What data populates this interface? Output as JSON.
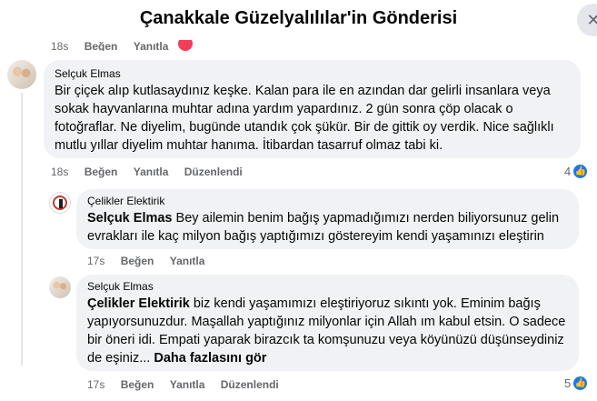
{
  "header": {
    "title": "Çanakkale Güzelyalılılar'in Gönderisi",
    "close_icon": "✕"
  },
  "previous_actions": {
    "time": "18s",
    "like": "Beğen",
    "reply": "Yanıtla"
  },
  "comments": [
    {
      "author": "Selçuk Elmas",
      "text": "Bir çiçek alıp kutlasaydınız keşke. Kalan para ile en azından dar gelirli insanlara veya sokak hayvanlarına muhtar adına yardım yapardınız. 2 gün sonra çöp olacak o fotoğraflar. Ne diyelim, bugünde utandık çok şükür. Bir de gittik oy verdik. Nice sağlıklı mutlu yıllar diyelim muhtar hanıma. İtibardan tasarruf olmaz tabi ki.",
      "time": "18s",
      "like": "Beğen",
      "reply": "Yanıtla",
      "edited": "Düzenlendi",
      "reaction_count": "4"
    },
    {
      "author": "Çelikler Elektirik",
      "mention": "Selçuk Elmas",
      "text": " Bey ailemin benim bağış yapmadığımızı nerden biliyorsunuz gelin evrakları ile kaç milyon bağış yaptığımızı göstereyim kendi yaşamınızı eleştirin",
      "time": "17s",
      "like": "Beğen",
      "reply": "Yanıtla"
    },
    {
      "author": "Selçuk Elmas",
      "mention": "Çelikler Elektirik",
      "text": " biz kendi yaşamımızı eleştiriyoruz sıkıntı yok. Eminim bağış yapıyorsunuzdur. Maşallah yaptığınız milyonlar için Allah ım kabul etsin. O sadece bir öneri idi. Empati yaparak birazcık ta komşunuzu veya köyünüzü düşünseydiniz de eşiniz... ",
      "more": "Daha fazlasını gör",
      "time": "17s",
      "like": "Beğen",
      "reply": "Yanıtla",
      "edited": "Düzenlendi",
      "reaction_count": "5"
    }
  ],
  "colors": {
    "bubble": "#f0f2f5",
    "meta": "#65676b",
    "like": "#1877f2"
  }
}
